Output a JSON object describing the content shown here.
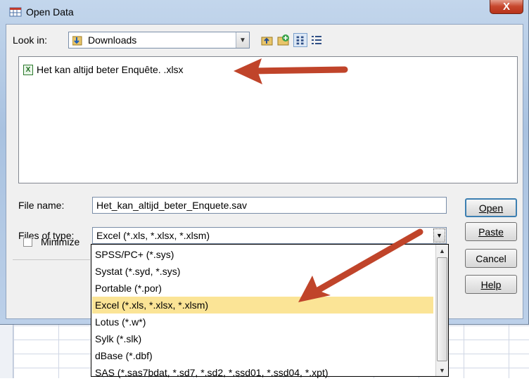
{
  "window": {
    "title": "Open Data",
    "close_glyph": "X"
  },
  "toolbar": {
    "look_in_label": "Look in:",
    "look_in_value": "Downloads",
    "icons": [
      "up-folder-icon",
      "new-folder-icon",
      "list-view-icon",
      "details-view-icon"
    ]
  },
  "file_list": {
    "items": [
      {
        "icon": "excel-file-icon",
        "name": "Het kan altijd beter  Enquête. .xlsx"
      }
    ]
  },
  "form": {
    "file_name_label": "File name:",
    "file_name_value": "Het_kan_altijd_beter_Enquete.sav",
    "files_of_type_label": "Files of type:",
    "files_of_type_value": "Excel (*.xls, *.xlsx, *.xlsm)",
    "minimize_label": "Minimize"
  },
  "buttons": {
    "open": "Open",
    "paste": "Paste",
    "cancel": "Cancel",
    "help": "Help"
  },
  "type_options": [
    "SPSS/PC+ (*.sys)",
    "Systat (*.syd, *.sys)",
    "Portable (*.por)",
    "Excel (*.xls, *.xlsx, *.xlsm)",
    "Lotus (*.w*)",
    "Sylk (*.slk)",
    "dBase (*.dbf)",
    "SAS (*.sas7bdat, *.sd7, *.sd2, *.ssd01, *.ssd04, *.xpt)"
  ],
  "selected_type_index": 3,
  "colors": {
    "annotation_arrow": "#c0442a",
    "selected_highlight": "#fbe496",
    "dialog_frame": "#b4cbe6"
  }
}
